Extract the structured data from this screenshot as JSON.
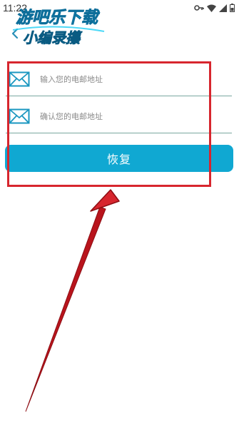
{
  "status_bar": {
    "time": "11:22"
  },
  "watermark": {
    "line1": "游吧乐下载",
    "line2": "小编录攥"
  },
  "form": {
    "email": {
      "placeholder": "输入您的电邮地址",
      "value": ""
    },
    "confirm_email": {
      "placeholder": "确认您的电邮地址",
      "value": ""
    },
    "recover_label": "恢复"
  },
  "colors": {
    "accent": "#10a8d2",
    "divider": "#7aa8a0",
    "annotation": "#d7262e",
    "icon": "#1b97c0"
  },
  "icons": [
    "back-chevron-icon",
    "email-icon",
    "vpn-key-icon",
    "wifi-icon",
    "signal-icon",
    "battery-icon"
  ]
}
